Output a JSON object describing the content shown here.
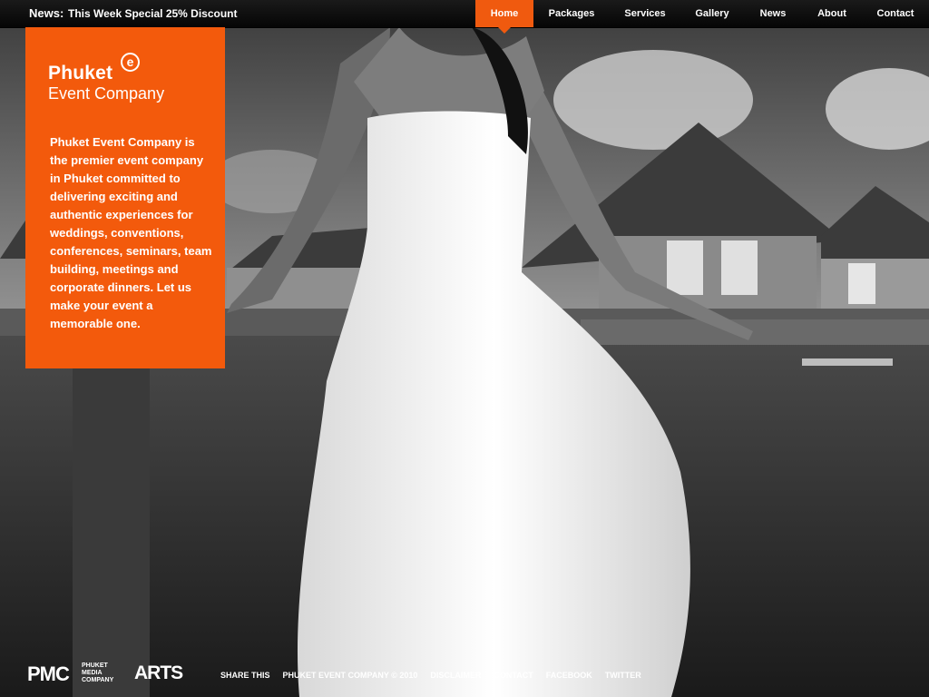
{
  "header": {
    "news_label": "News:",
    "news_text": "This Week Special 25% Discount",
    "nav": [
      {
        "label": "Home",
        "active": true
      },
      {
        "label": "Packages",
        "active": false
      },
      {
        "label": "Services",
        "active": false
      },
      {
        "label": "Gallery",
        "active": false
      },
      {
        "label": "News",
        "active": false
      },
      {
        "label": "About",
        "active": false
      },
      {
        "label": "Contact",
        "active": false
      }
    ]
  },
  "panel": {
    "logo_main": "Phuket",
    "logo_mark": "e",
    "logo_sub": "Event Company",
    "description": "Phuket Event Company is the premier event company in Phuket committed to delivering exciting and authentic experiences for weddings, conventions, conferences, seminars, team building, meetings and corporate dinners. Let us make your event a memorable one."
  },
  "footer": {
    "pmc_logo": "PMC",
    "pmc_sub": "PHUKET MEDIA COMPANY",
    "arts_logo": "ARTS",
    "links": [
      "SHARE THIS",
      "PHUKET EVENT COMPANY © 2010",
      "DISCLAIMER",
      "CONTACT",
      "FACEBOOK",
      "TWITTER"
    ]
  },
  "colors": {
    "accent": "#f35a0c",
    "topbar": "#0a0a0a"
  }
}
